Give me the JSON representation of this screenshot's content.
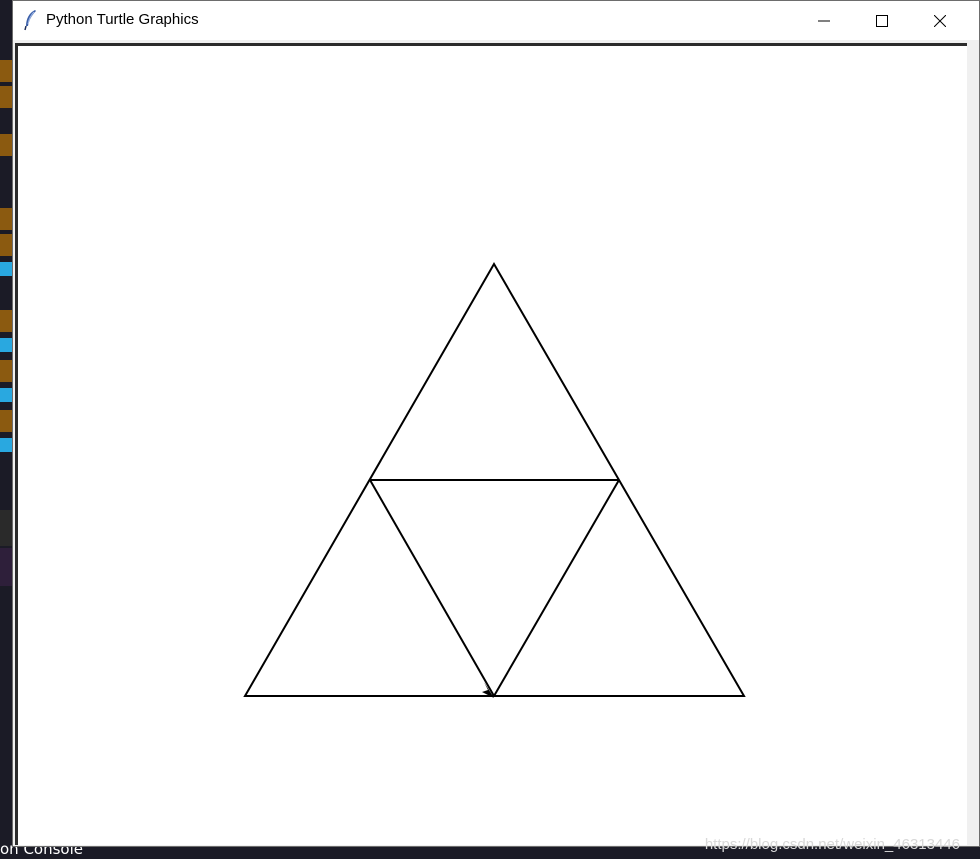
{
  "window": {
    "title": "Python Turtle Graphics",
    "minimize_label": "Minimize",
    "maximize_label": "Maximize",
    "close_label": "Close"
  },
  "background": {
    "console_label": "on Console",
    "colors": {
      "editor": "#1b1b26",
      "highlight": "#8b5a10",
      "keyword": "#29a8e0",
      "selection": "#0a0aa0"
    }
  },
  "canvas": {
    "background": "#ffffff",
    "stroke_color": "#000000",
    "shape": "sierpinski-triangle-level-1",
    "turtle_icon": "arrow-turtle-icon"
  },
  "watermark": {
    "text": "https://blog.csdn.net/weixin_46313446"
  }
}
